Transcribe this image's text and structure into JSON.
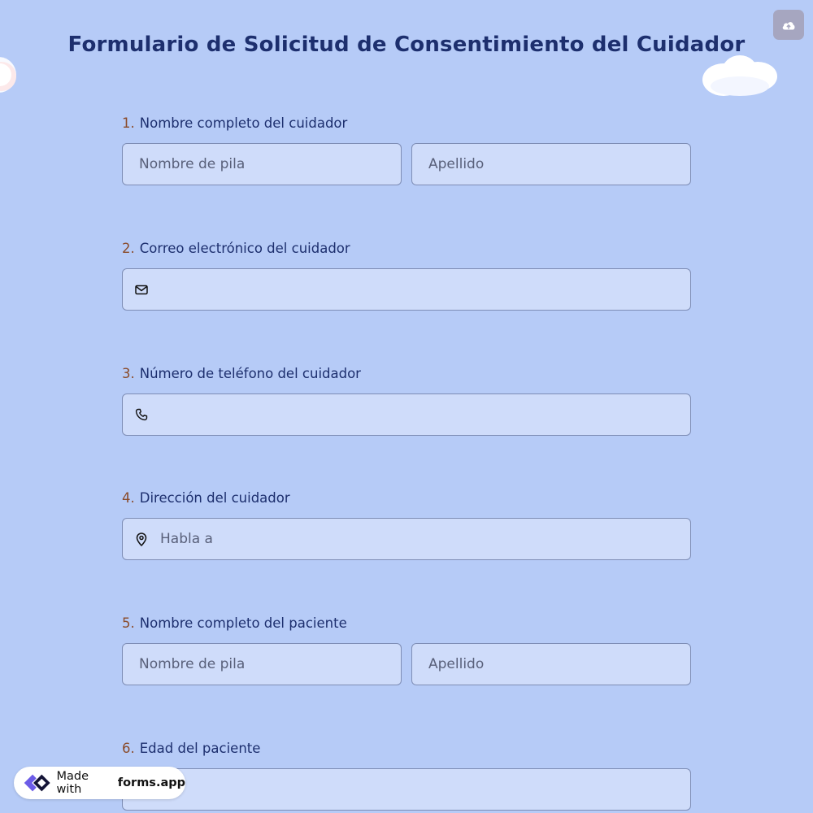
{
  "header": {
    "title": "Formulario de Solicitud de Consentimiento del Cuidador",
    "upload_icon": "cloud-upload-icon"
  },
  "colors": {
    "background": "#b6cbf7",
    "field_background": "#cfdcfa",
    "title": "#1d2f6e",
    "number": "#8a4b2a"
  },
  "questions": [
    {
      "number": "1.",
      "label": "Nombre completo del cuidador",
      "first_placeholder": "Nombre de pila",
      "last_placeholder": "Apellido"
    },
    {
      "number": "2.",
      "label": "Correo electrónico del cuidador",
      "icon": "envelope-icon",
      "placeholder": ""
    },
    {
      "number": "3.",
      "label": "Número de teléfono del cuidador",
      "icon": "phone-icon",
      "placeholder": ""
    },
    {
      "number": "4.",
      "label": "Dirección del cuidador",
      "icon": "map-pin-icon",
      "placeholder": "Habla a"
    },
    {
      "number": "5.",
      "label": "Nombre completo del paciente",
      "first_placeholder": "Nombre de pila",
      "last_placeholder": "Apellido"
    },
    {
      "number": "6.",
      "label": "Edad del paciente",
      "placeholder": ""
    }
  ],
  "badge": {
    "prefix": "Made with",
    "brand": "forms.app",
    "icon": "forms-app-logo"
  }
}
